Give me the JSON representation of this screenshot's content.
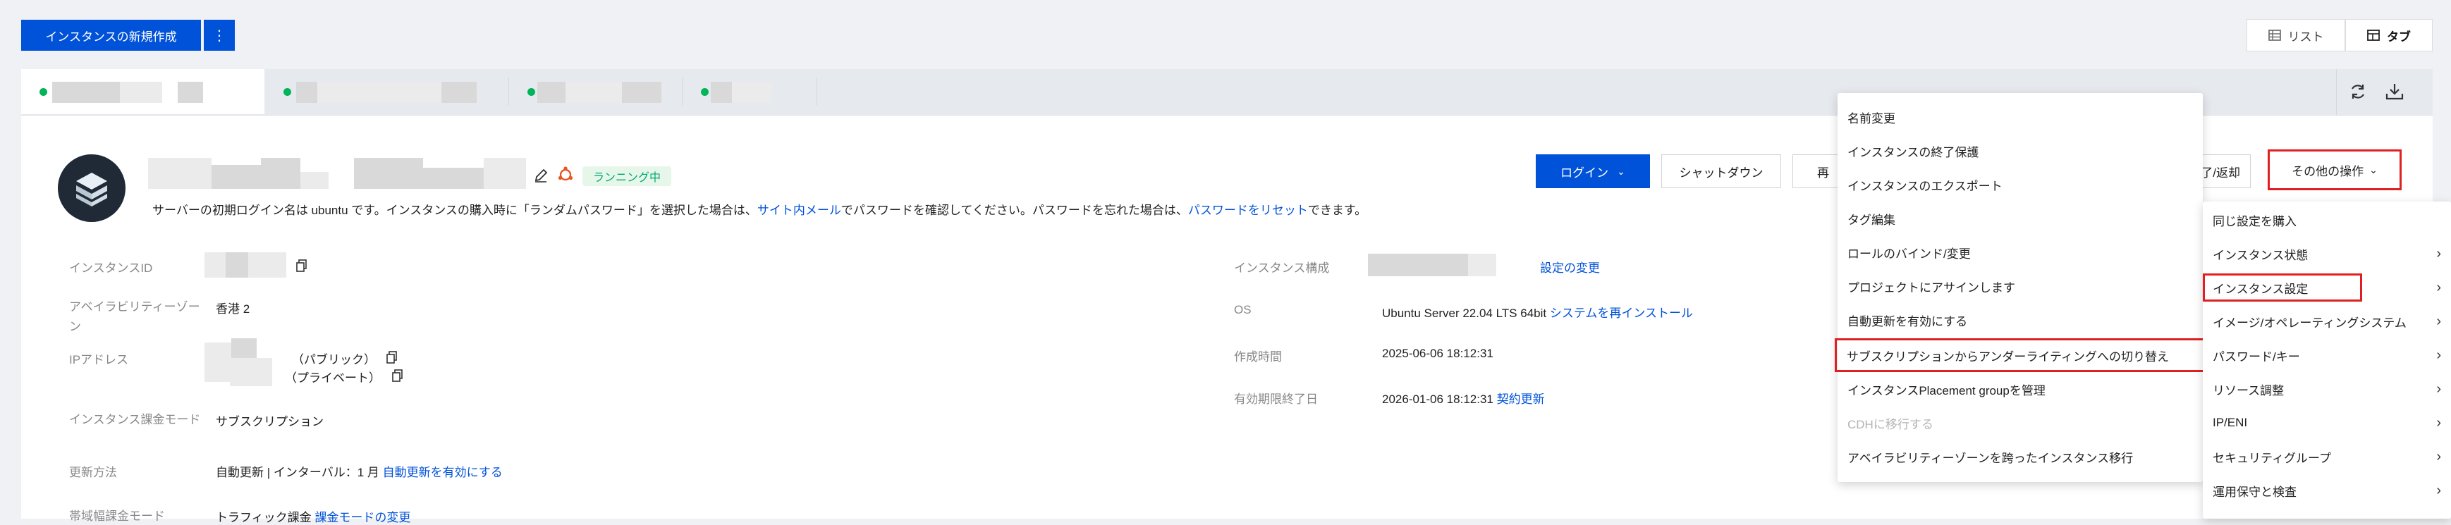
{
  "toolbar": {
    "create_instance": "インスタンスの新規作成",
    "more_icon": "more-vertical-icon",
    "view_list": "リスト",
    "view_tab": "タブ"
  },
  "tabs": {
    "refresh_icon": "refresh-icon",
    "download_icon": "download-icon"
  },
  "instance": {
    "status": "ランニング中",
    "login_notice_prefix": "サーバーの初期ログイン名は ubuntu です。インスタンスの購入時に「ランダムパスワード」を選択した場合は、",
    "login_notice_link1": "サイト内メール",
    "login_notice_mid": "でパスワードを確認してください。パスワードを忘れた場合は、",
    "login_notice_link2": "パスワードをリセット",
    "login_notice_suffix": "できます。",
    "actions": {
      "login": "ログイン",
      "shutdown": "シャットダウン",
      "restart_partial": "再",
      "return_partial": "了/返却",
      "more_ops": "その他の操作"
    },
    "fields": {
      "id_label": "インスタンスID",
      "az_label": "アベイラビリティーゾーン",
      "az_value": "香港 2",
      "ip_label": "IPアドレス",
      "ip_public": "（パブリック）",
      "ip_private": "（プライベート）",
      "billing_label": "インスタンス課金モード",
      "billing_value": "サブスクリプション",
      "renew_label": "更新方法",
      "renew_value": "自動更新 | インターバル：1 月",
      "renew_link": "自動更新を有効にする",
      "bandwidth_label": "帯域幅課金モード",
      "bandwidth_value": "トラフィック課金",
      "bandwidth_link": "課金モードの変更",
      "config_label": "インスタンス構成",
      "config_link": "設定の変更",
      "os_label": "OS",
      "os_value": "Ubuntu Server 22.04 LTS 64bit",
      "os_link": "システムを再インストール",
      "created_label": "作成時間",
      "created_value": "2025-06-06 18:12:31",
      "expire_label": "有効期限終了日",
      "expire_value": "2026-01-06 18:12:31",
      "expire_link": "契約更新"
    }
  },
  "submenu": {
    "items": [
      "名前変更",
      "インスタンスの終了保護",
      "インスタンスのエクスポート",
      "タグ編集",
      "ロールのバインド/変更",
      "プロジェクトにアサインします",
      "自動更新を有効にする",
      "サブスクリプションからアンダーライティングへの切り替え",
      "インスタンスPlacement groupを管理",
      "CDHに移行する",
      "アベイラビリティーゾーンを跨ったインスタンス移行"
    ]
  },
  "more_menu": {
    "items": [
      "同じ設定を購入",
      "インスタンス状態",
      "インスタンス設定",
      "イメージ/オペレーティングシステム",
      "パスワード/キー",
      "リソース調整",
      "IP/ENI",
      "セキュリティグループ",
      "運用保守と検査"
    ]
  },
  "colors": {
    "primary": "#0052d9",
    "status_green": "#00a870",
    "highlight_red": "#e02020"
  }
}
